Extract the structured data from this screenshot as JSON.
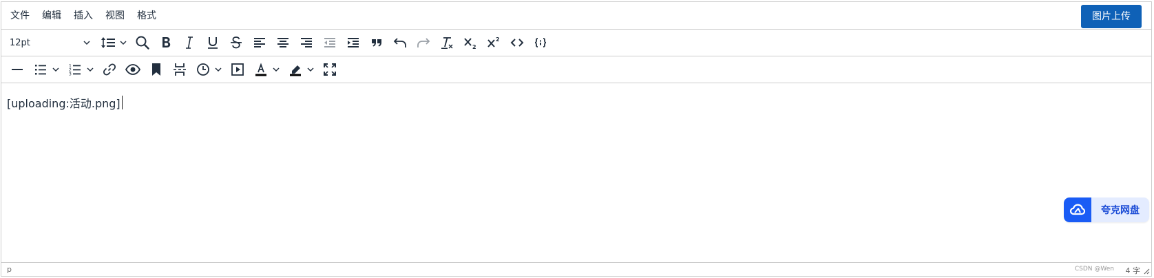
{
  "menubar": {
    "items": [
      "文件",
      "编辑",
      "插入",
      "视图",
      "格式"
    ],
    "upload_button": "图片上传"
  },
  "toolbar": {
    "font_size": "12pt",
    "row1_icons": [
      "line-height-icon",
      "search-icon",
      "bold-icon",
      "italic-icon",
      "underline-icon",
      "strikethrough-icon",
      "align-left-icon",
      "align-center-icon",
      "align-right-icon",
      "outdent-icon",
      "indent-icon",
      "blockquote-icon",
      "undo-icon",
      "redo-icon",
      "remove-format-icon",
      "subscript-icon",
      "superscript-icon",
      "code-icon",
      "code-sample-icon"
    ],
    "row2_icons": [
      "horizontal-line-icon",
      "bullet-list-icon",
      "numbered-list-icon",
      "link-icon",
      "preview-icon",
      "bookmark-icon",
      "page-break-icon",
      "insert-datetime-icon",
      "media-icon",
      "text-color-icon",
      "highlight-color-icon",
      "fullscreen-icon"
    ]
  },
  "content": {
    "text": "[uploading:活动.png]"
  },
  "statusbar": {
    "path": "p",
    "word_count": "4 字",
    "watermark": "CSDN @Wen"
  },
  "quark": {
    "label": "夸克网盘"
  },
  "colors": {
    "primary": "#0f61b7",
    "icon": "#222f3e",
    "border": "#cccccc",
    "quark_blue": "#1a5cf5"
  }
}
